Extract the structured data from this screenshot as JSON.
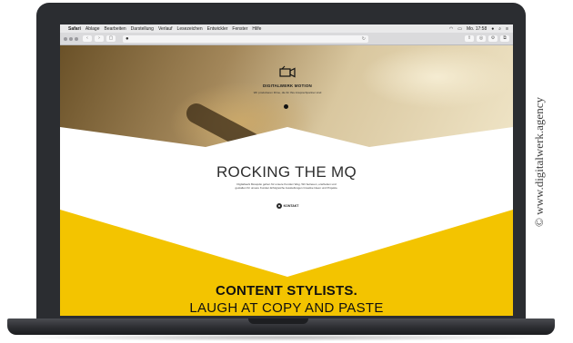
{
  "menubar": {
    "apple": "",
    "items": [
      "Safari",
      "Ablage",
      "Bearbeiten",
      "Darstellung",
      "Verlauf",
      "Lesezeichen",
      "Entwickler",
      "Fenster",
      "Hilfe"
    ],
    "clock": "Mo. 17:58"
  },
  "toolbar": {
    "back": "‹",
    "forward": "›",
    "sidebar": "▢",
    "shield": "●",
    "reload": "↻"
  },
  "site": {
    "brand": "DIGITALWERK MOTION",
    "brand_sub": "Wir produzieren Filme, die für Ihre Ansprechpartner sind",
    "heading": "ROCKING THE MQ",
    "text": "Digitalwerk Mosquito gehen für unsere Kunden Weg. Wir betreuen, erarbeiten und gestalten für unsere Kunden Erfolgreiche Ausstellungen Creative Ideen und Projekte.",
    "contact": "KONTAKT",
    "content_heading": "CONTENT STYLISTS.",
    "content_sub": "LAUGH AT COPY AND PASTE"
  },
  "credit": "© www.digitalwerk.agency",
  "colors": {
    "bezel": "#2b2d31",
    "yellow": "#f3c400",
    "dark": "#111111"
  }
}
